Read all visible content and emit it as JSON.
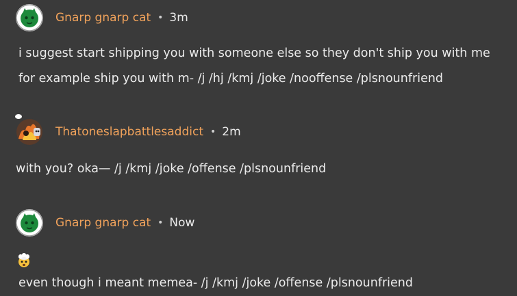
{
  "comments": [
    {
      "author": "Gnarp gnarp cat",
      "separator": "•",
      "time": "3m",
      "avatar_icon": "green-cat-avatar-icon",
      "lines": [
        "i suggest start shipping you with someone else so they don't ship you with me",
        "for example ship you with m- /j /hj /kmj /joke /nooffense /plsnounfriend"
      ]
    },
    {
      "author": "Thatoneslapbattlesaddict",
      "separator": "•",
      "time": "2m",
      "avatar_icon": "fire-character-avatar-icon",
      "lines": [
        "with you? oka— /j /kmj /joke /offense /plsnounfriend"
      ]
    },
    {
      "author": "Gnarp gnarp cat",
      "separator": "•",
      "time": "Now",
      "avatar_icon": "green-cat-avatar-icon",
      "emoji": "exploding-head-emoji",
      "lines": [
        "even though i meant memea- /j /kmj /joke /offense /plsnounfriend"
      ]
    }
  ],
  "colors": {
    "background": "#3a3a3a",
    "author": "#f0a25b",
    "text": "#ebebeb"
  }
}
